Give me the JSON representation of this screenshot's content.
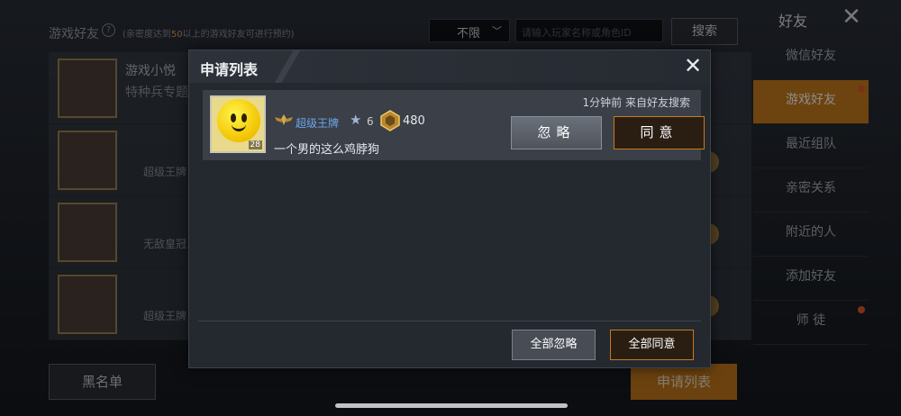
{
  "background": {
    "title": "游戏好友",
    "help_glyph": "?",
    "note_prefix": "(亲密度达到",
    "note_highlight": "50",
    "note_suffix": "以上的游戏好友可进行预约)",
    "filter_value": "不限",
    "search_placeholder": "请输入玩家名称或角色ID",
    "search_button": "搜索",
    "side_title": "好友",
    "close_glyph": "✕",
    "side_items": [
      {
        "label": "微信好友",
        "active": false,
        "dot": false
      },
      {
        "label": "游戏好友",
        "active": true,
        "dot": true
      },
      {
        "label": "最近组队",
        "active": false,
        "dot": false
      },
      {
        "label": "亲密关系",
        "active": false,
        "dot": false
      },
      {
        "label": "附近的人",
        "active": false,
        "dot": false
      },
      {
        "label": "添加好友",
        "active": false,
        "dot": false
      },
      {
        "label": "师 徒",
        "active": false,
        "dot": true
      }
    ],
    "friend_rows": [
      {
        "name": "游戏小悦",
        "sub": "特种兵专题"
      },
      {
        "name": "",
        "sub": "超级王牌"
      },
      {
        "name": "",
        "sub": "无敌皇冠"
      },
      {
        "name": "",
        "sub": "超级王牌"
      }
    ],
    "blacklist_button": "黑名单",
    "apply_list_button": "申请列表"
  },
  "modal": {
    "title": "申请列表",
    "close_glyph": "✕",
    "requests": [
      {
        "time_source": "1分钟前 来自好友搜索",
        "rank": "超级王牌",
        "stars": "6",
        "score": "480",
        "level": "28",
        "name": "一个男的这么鸡脖狗",
        "ignore_label": "忽略",
        "agree_label": "同意"
      }
    ],
    "ignore_all_label": "全部忽略",
    "agree_all_label": "全部同意"
  },
  "colors": {
    "accent": "#c77a1e",
    "rank_text": "#6ea5ea"
  }
}
